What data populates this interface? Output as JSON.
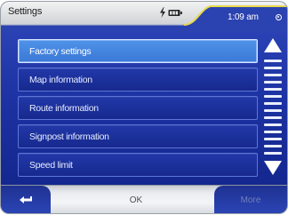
{
  "header": {
    "title": "Settings",
    "time": "1:09 am",
    "icons": [
      "charging-icon",
      "battery-icon",
      "gps-icon"
    ]
  },
  "menu": {
    "items": [
      {
        "label": "Factory settings",
        "selected": true
      },
      {
        "label": "Map information",
        "selected": false
      },
      {
        "label": "Route information",
        "selected": false
      },
      {
        "label": "Signpost information",
        "selected": false
      },
      {
        "label": "Speed limit",
        "selected": false
      }
    ]
  },
  "scrollbar": {
    "up_icon": "triangle-up-icon",
    "down_icon": "triangle-down-icon"
  },
  "footer": {
    "back_icon": "back-arrow-icon",
    "ok_label": "OK",
    "more_label": "More"
  },
  "colors": {
    "background": "#1a2f9a",
    "selected": "#4a8ce4",
    "header_accent": "#e8d94a"
  }
}
